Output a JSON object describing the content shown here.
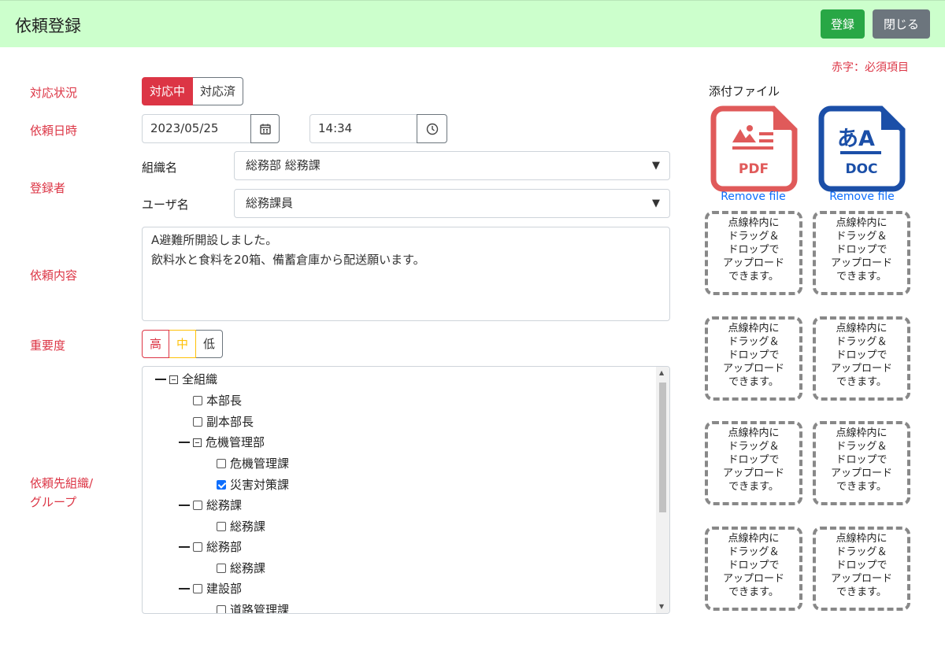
{
  "header": {
    "title": "依頼登録",
    "register_label": "登録",
    "close_label": "閉じる"
  },
  "required_note": "赤字：必須項目",
  "labels": {
    "status": "対応状況",
    "datetime": "依頼日時",
    "registrant": "登録者",
    "content": "依頼内容",
    "priority": "重要度",
    "target_line1": "依頼先組織/",
    "target_line2": "グループ"
  },
  "status": {
    "options": [
      "対応中",
      "対応済"
    ],
    "selected": "対応中"
  },
  "date": {
    "value": "2023/05/25",
    "icon": "calendar-icon"
  },
  "time": {
    "value": "14:34",
    "icon": "clock-icon"
  },
  "registrant": {
    "org_label": "組織名",
    "org_value": "総務部 総務課",
    "user_label": "ユーザ名",
    "user_value": "総務課員"
  },
  "content": {
    "line1": "A避難所開設しました。",
    "line2": "飲料水と食料を20箱、備蓄倉庫から配送願います。"
  },
  "priority": {
    "options": [
      "高",
      "中",
      "低"
    ],
    "colors": [
      "#dc3545",
      "#ffc107",
      "#6c757d"
    ]
  },
  "tree": {
    "items": [
      {
        "label": "全組織",
        "type": "group"
      },
      {
        "label": "本部長",
        "type": "leaf",
        "checked": false
      },
      {
        "label": "副本部長",
        "type": "leaf",
        "checked": false
      },
      {
        "label": "危機管理部",
        "type": "group"
      },
      {
        "label": "危機管理課",
        "type": "leaf",
        "checked": false
      },
      {
        "label": "災害対策課",
        "type": "leaf",
        "checked": true
      },
      {
        "label": "総務課",
        "type": "group-check",
        "checked": false
      },
      {
        "label": "総務課",
        "type": "leaf",
        "checked": false
      },
      {
        "label": "総務部",
        "type": "group-check",
        "checked": false
      },
      {
        "label": "総務課",
        "type": "leaf",
        "checked": false
      },
      {
        "label": "建設部",
        "type": "group-check",
        "checked": false
      },
      {
        "label": "道路管理課",
        "type": "leaf",
        "checked": false
      }
    ]
  },
  "attachments": {
    "title": "添付ファイル",
    "files": [
      {
        "type": "PDF",
        "icon": "pdf-file-icon",
        "color": "#e05a5a",
        "remove": "Remove file"
      },
      {
        "type": "DOC",
        "glyph": "あA",
        "icon": "doc-file-icon",
        "color": "#1b4fa8",
        "remove": "Remove file"
      }
    ],
    "drop": {
      "line1": "点線枠内に",
      "line2": "ドラッグ＆",
      "line3": "ドロップで",
      "line4": "アップロード",
      "line5": "できます。"
    }
  },
  "colors": {
    "header_bg": "#ccffcc",
    "required": "#dc3545",
    "primary": "#0d6efd",
    "success": "#28a745",
    "secondary": "#6c757d"
  }
}
